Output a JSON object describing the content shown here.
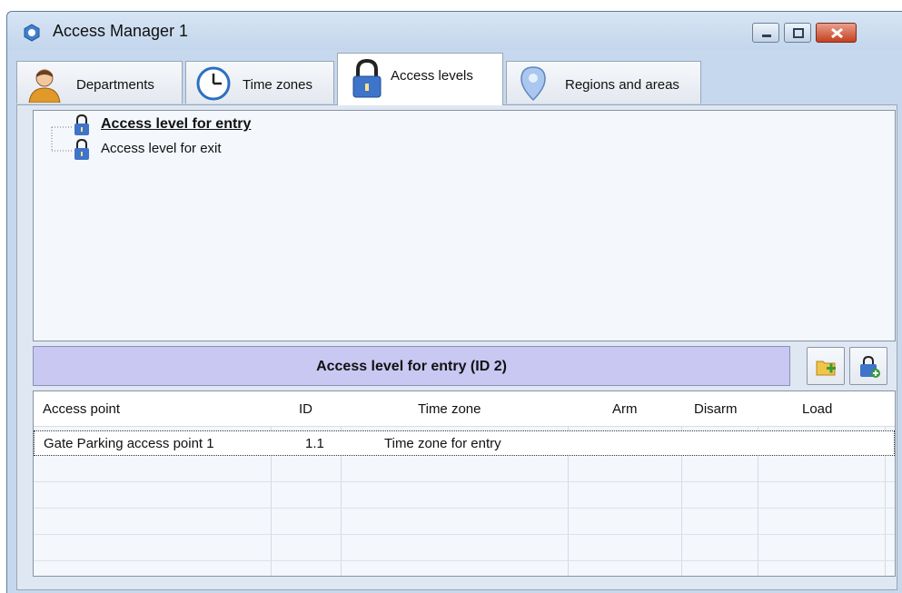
{
  "window": {
    "title": "Access Manager 1",
    "controls": {
      "minimize": "minimize",
      "maximize": "maximize",
      "close": "close"
    }
  },
  "tabs": [
    {
      "label": "Departments",
      "icon": "person-icon",
      "active": false
    },
    {
      "label": "Time zones",
      "icon": "clock-icon",
      "active": false
    },
    {
      "label": "Access levels",
      "icon": "padlock-icon",
      "active": true
    },
    {
      "label": "Regions and areas",
      "icon": "map-pin-icon",
      "active": false
    }
  ],
  "tree": {
    "items": [
      {
        "label": "Access level for entry",
        "selected": true
      },
      {
        "label": "Access level for exit",
        "selected": false
      }
    ]
  },
  "detail": {
    "title": "Access level for entry (ID 2)",
    "buttons": [
      {
        "name": "add-folder-button",
        "icon": "folder-add-icon"
      },
      {
        "name": "add-access-level-button",
        "icon": "padlock-add-icon"
      }
    ]
  },
  "grid": {
    "columns": [
      "Access point",
      "ID",
      "Time zone",
      "Arm",
      "Disarm",
      "Load"
    ],
    "rows": [
      {
        "access_point": "Gate Parking access point 1",
        "id": "1.1",
        "time_zone": "Time zone for entry",
        "arm": "",
        "disarm": "",
        "load": ""
      }
    ]
  },
  "colors": {
    "title_bar": "#c6d8ee",
    "header_bar": "#c9c8f3",
    "panel": "#f4f7fc",
    "close_button": "#c5401f"
  }
}
